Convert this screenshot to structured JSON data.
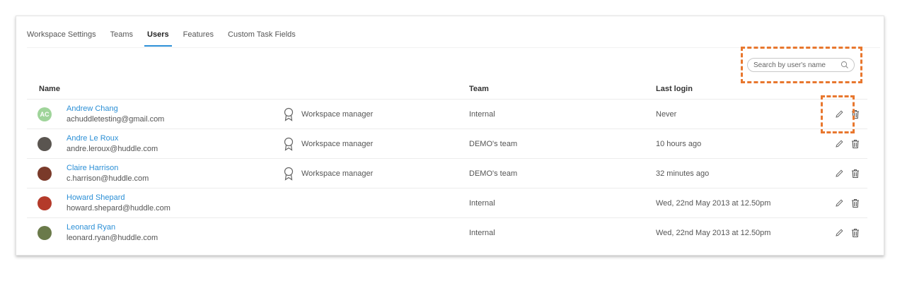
{
  "tabs": [
    {
      "label": "Workspace Settings",
      "active": false
    },
    {
      "label": "Teams",
      "active": false
    },
    {
      "label": "Users",
      "active": true
    },
    {
      "label": "Features",
      "active": false
    },
    {
      "label": "Custom Task Fields",
      "active": false
    }
  ],
  "search": {
    "placeholder": "Search by user's name",
    "value": ""
  },
  "columns": {
    "name": "Name",
    "team": "Team",
    "last_login": "Last login"
  },
  "users": [
    {
      "name": "Andrew Chang",
      "email": "achuddletesting@gmail.com",
      "avatar_initials": "AC",
      "avatar_color": "#9fd49a",
      "role": "Workspace manager",
      "team": "Internal",
      "last_login": "Never"
    },
    {
      "name": "Andre Le Roux",
      "email": "andre.leroux@huddle.com",
      "avatar_initials": "",
      "avatar_color": "#5a5550",
      "role": "Workspace manager",
      "team": "DEMO's team",
      "last_login": "10 hours ago"
    },
    {
      "name": "Claire Harrison",
      "email": "c.harrison@huddle.com",
      "avatar_initials": "",
      "avatar_color": "#7a3a2a",
      "role": "Workspace manager",
      "team": "DEMO's team",
      "last_login": "32 minutes ago"
    },
    {
      "name": "Howard Shepard",
      "email": "howard.shepard@huddle.com",
      "avatar_initials": "",
      "avatar_color": "#b43a2a",
      "role": "",
      "team": "Internal",
      "last_login": "Wed, 22nd May 2013 at 12.50pm"
    },
    {
      "name": "Leonard Ryan",
      "email": "leonard.ryan@huddle.com",
      "avatar_initials": "",
      "avatar_color": "#6a7a4a",
      "role": "",
      "team": "Internal",
      "last_login": "Wed, 22nd May 2013 at 12.50pm"
    }
  ],
  "colors": {
    "accent": "#2b8fd6",
    "highlight": "#e8772e"
  }
}
